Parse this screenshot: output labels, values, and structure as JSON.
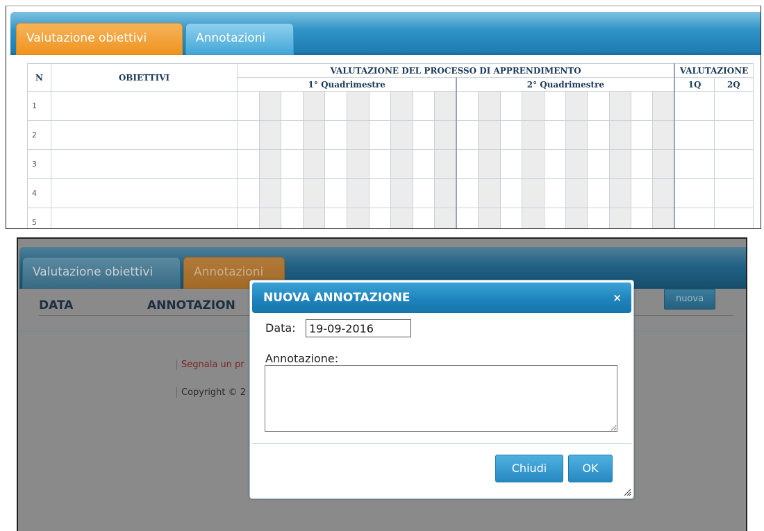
{
  "top": {
    "tabs": [
      {
        "label": "Valutazione obiettivi",
        "active": true
      },
      {
        "label": "Annotazioni",
        "active": false
      }
    ],
    "table": {
      "headers": {
        "n": "N",
        "obiettivi": "OBIETTIVI",
        "processo": "VALUTAZIONE DEL PROCESSO DI APPRENDIMENTO",
        "q1": "1° Quadrimestre",
        "q2": "2° Quadrimestre",
        "valutazione": "VALUTAZIONE",
        "v1": "1Q",
        "v2": "2Q"
      },
      "rows": [
        "1",
        "2",
        "3",
        "4",
        "5"
      ]
    }
  },
  "bottom": {
    "tabs": [
      {
        "label": "Valutazione obiettivi",
        "active": false
      },
      {
        "label": "Annotazioni",
        "active": true
      }
    ],
    "header": {
      "data": "DATA",
      "annotazioni": "ANNOTAZION"
    },
    "nuova_label": "nuova",
    "footer": {
      "segnala": "Segnala un pr",
      "copyright": "Copyright © 2"
    }
  },
  "dialog": {
    "title": "NUOVA ANNOTAZIONE",
    "close_icon": "×",
    "data_label": "Data:",
    "data_value": "19-09-2016",
    "annotazione_label": "Annotazione:",
    "annotazione_value": "",
    "buttons": {
      "chiudi": "Chiudi",
      "ok": "OK"
    }
  },
  "colors": {
    "tab_active": "#ef9420",
    "tab_bar": "#2f93c7",
    "dialog_title": "#1f84bd",
    "overlay": "#8a8a8a"
  }
}
